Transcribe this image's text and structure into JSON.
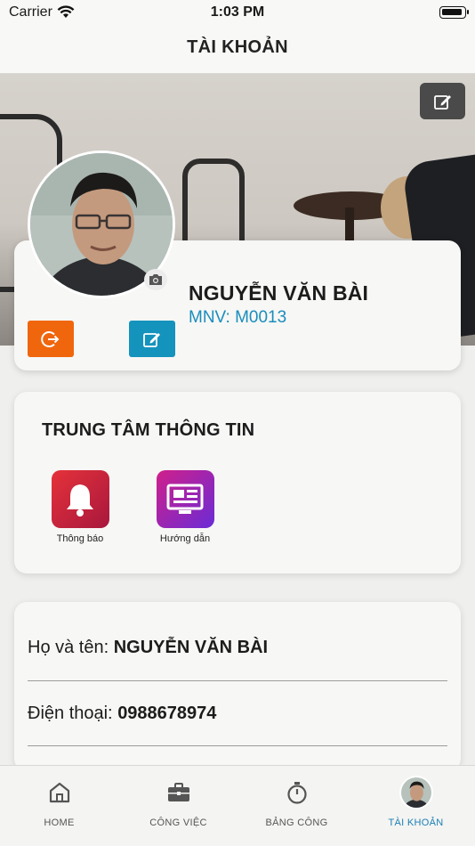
{
  "status_bar": {
    "carrier": "Carrier",
    "time": "1:03 PM"
  },
  "header": {
    "title": "TÀI KHOẢN"
  },
  "profile": {
    "name": "NGUYỄN VĂN BÀI",
    "employee_code": "MNV: M0013"
  },
  "info_center": {
    "title": "TRUNG TÂM THÔNG TIN",
    "items": [
      {
        "label": "Thông báo",
        "icon": "bell-icon"
      },
      {
        "label": "Hướng dẫn",
        "icon": "news-screen-icon"
      }
    ]
  },
  "details": {
    "full_name_label": "Họ và tên:",
    "full_name_value": "NGUYỄN VĂN BÀI",
    "phone_label": "Điện thoại:",
    "phone_value": "0988678974"
  },
  "tabbar": {
    "items": [
      {
        "label": "HOME",
        "icon": "home-icon",
        "active": false
      },
      {
        "label": "CÔNG VIỆC",
        "icon": "briefcase-icon",
        "active": false
      },
      {
        "label": "BẢNG CÔNG",
        "icon": "stopwatch-icon",
        "active": false
      },
      {
        "label": "TÀI KHOẢN",
        "icon": "avatar",
        "active": true
      }
    ]
  },
  "colors": {
    "logout": "#f0660d",
    "edit": "#1493bd",
    "accent_text": "#1a8dbd",
    "active_tab": "#1a7fb4"
  }
}
